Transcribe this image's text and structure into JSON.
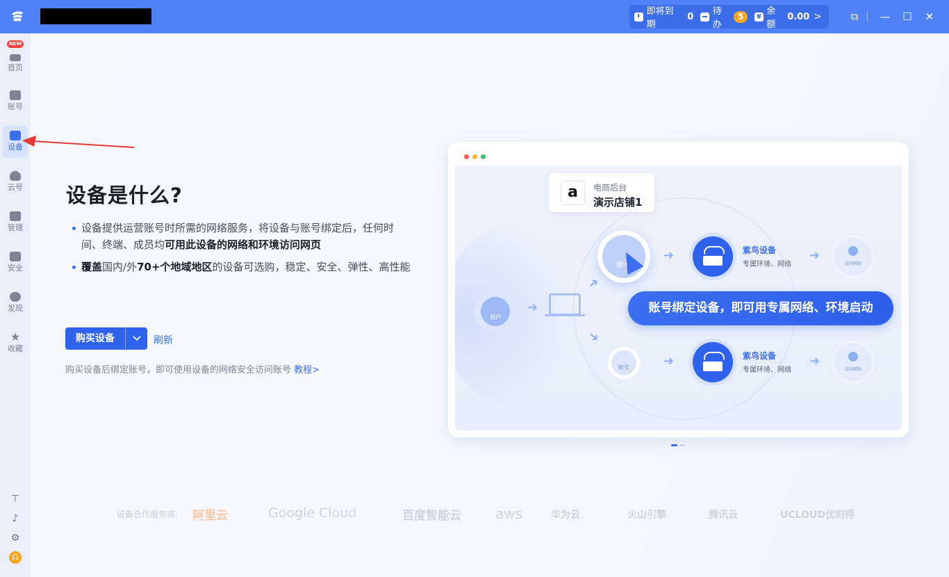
{
  "titlebar": {
    "expiring_label": "即将到期",
    "expiring_count": "0",
    "todo_label": "待办",
    "todo_count": "5",
    "balance_label": "余额",
    "balance_value": "0.00",
    "chevron": ">",
    "win_minimize": "—",
    "win_maximize": "☐",
    "win_close": "✕",
    "win_pin": "⧉"
  },
  "sidebar": {
    "new_badge": "NEW",
    "items": [
      {
        "label": "首页",
        "icon": "home-icon"
      },
      {
        "label": "账号",
        "icon": "store-icon"
      },
      {
        "label": "设备",
        "icon": "server-icon"
      },
      {
        "label": "云号",
        "icon": "cloud-icon"
      },
      {
        "label": "管理",
        "icon": "manage-icon"
      },
      {
        "label": "安全",
        "icon": "shield-icon"
      },
      {
        "label": "发现",
        "icon": "compass-icon"
      },
      {
        "label": "收藏",
        "icon": "star-icon"
      }
    ],
    "bottom": [
      "signpost-icon",
      "bell-icon",
      "gear-icon",
      "headset-icon"
    ]
  },
  "main": {
    "heading": "设备是什么?",
    "bullet1_part1": "设备提供运营账号时所需的网络服务，将设备与账号绑定后，任何时间、终端、成员均",
    "bullet1_bold": "可用此设备的网络和环境访问网页",
    "bullet2_bold1": "覆盖",
    "bullet2_part1": "国内/外",
    "bullet2_bold2": "70+个地域地区",
    "bullet2_part2": "的设备可选购，稳定、安全、弹性、高性能",
    "buy_button": "购买设备",
    "refresh": "刷新",
    "hint_text": "购买设备后绑定账号，即可使用设备的网络安全访问账号 ",
    "tutorial_link": "教程>"
  },
  "illustration": {
    "store_category": "电商后台",
    "store_name": "演示店铺1",
    "amazon_letter": "a",
    "user_label": "用户",
    "account_label": "账号",
    "device_title": "紫鸟设备",
    "device_sub": "专属环境、网络",
    "web_label": "访问网站",
    "banner": "账号绑定设备，即可用专属网络、环境启动"
  },
  "partners": {
    "label": "设备合作服务商:",
    "names": [
      "阿里云",
      "Google Cloud",
      "百度智能云",
      "aws",
      "华为云",
      "火山引擎",
      "腾讯云",
      "UCLOUD优刻得"
    ]
  },
  "colors": {
    "accent": "#2f63ee",
    "titlebar": "#4f82f5",
    "badge": "#f5a623",
    "annotation": "#e53935"
  }
}
